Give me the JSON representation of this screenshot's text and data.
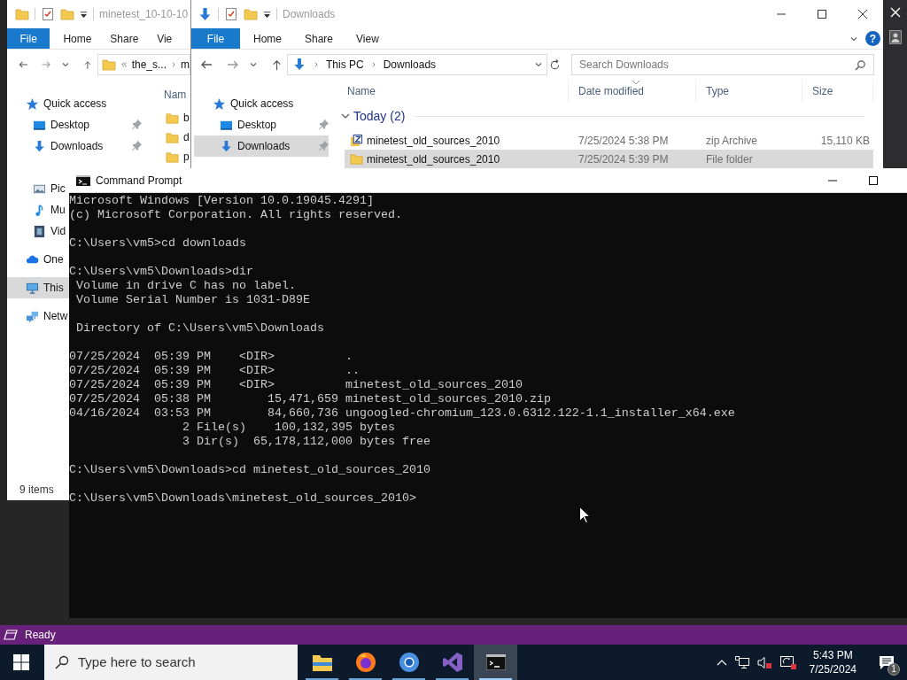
{
  "explorer_back": {
    "title": "minetest_10-10-10",
    "ribbon_tabs": [
      {
        "label": "File",
        "kind": "file"
      },
      {
        "label": "Home",
        "kind": "tab"
      },
      {
        "label": "Share",
        "kind": "tab"
      },
      {
        "label": "Vie",
        "kind": "tab"
      }
    ],
    "address": [
      "the_s...",
      "m"
    ],
    "column_header": "Nam",
    "nav_sections": [
      {
        "items": [
          {
            "label": "Quick access",
            "kind": "quick",
            "pinned": false,
            "selected": false
          },
          {
            "label": "Desktop",
            "kind": "desktop",
            "pinned": true,
            "selected": false
          },
          {
            "label": "Downloads",
            "kind": "downloads",
            "pinned": true,
            "selected": false
          }
        ]
      },
      {
        "items": [
          {
            "label": "Pic",
            "kind": "pictures",
            "selected": false
          },
          {
            "label": "Mu",
            "kind": "music",
            "selected": false
          },
          {
            "label": "Vid",
            "kind": "videos",
            "selected": false
          }
        ]
      },
      {
        "items": [
          {
            "label": "One",
            "kind": "onedrive",
            "selected": false
          }
        ]
      },
      {
        "items": [
          {
            "label": "This",
            "kind": "pc",
            "selected": true
          }
        ]
      },
      {
        "items": [
          {
            "label": "Netw",
            "kind": "network",
            "selected": false
          }
        ]
      }
    ],
    "files": [
      "b",
      "d",
      "p"
    ],
    "status": "9 items"
  },
  "explorer_front": {
    "title": "Downloads",
    "ribbon_tabs": [
      {
        "label": "File",
        "kind": "file"
      },
      {
        "label": "Home",
        "kind": "tab"
      },
      {
        "label": "Share",
        "kind": "tab"
      },
      {
        "label": "View",
        "kind": "tab"
      }
    ],
    "help_label": "?",
    "address": [
      "This PC",
      "Downloads"
    ],
    "search": {
      "placeholder": "Search Downloads"
    },
    "nav_items": [
      {
        "label": "Quick access",
        "kind": "quick",
        "pinned": false,
        "selected": false
      },
      {
        "label": "Desktop",
        "kind": "desktop",
        "pinned": true,
        "selected": false
      },
      {
        "label": "Downloads",
        "kind": "downloads",
        "pinned": true,
        "selected": true
      }
    ],
    "columns": [
      "Name",
      "Date modified",
      "Type",
      "Size"
    ],
    "group": "Today (2)",
    "rows": [
      {
        "kind": "zip",
        "name": "minetest_old_sources_2010",
        "date": "7/25/2024 5:38 PM",
        "type": "zip Archive",
        "size": "15,110 KB",
        "selected": false
      },
      {
        "kind": "folder",
        "name": "minetest_old_sources_2010",
        "date": "7/25/2024 5:39 PM",
        "type": "File folder",
        "selected": true
      }
    ]
  },
  "command_prompt": {
    "title": "Command Prompt",
    "output": "Microsoft Windows [Version 10.0.19045.4291]\n(c) Microsoft Corporation. All rights reserved.\n\nC:\\Users\\vm5>cd downloads\n\nC:\\Users\\vm5\\Downloads>dir\n Volume in drive C has no label.\n Volume Serial Number is 1031-D89E\n\n Directory of C:\\Users\\vm5\\Downloads\n\n07/25/2024  05:39 PM    <DIR>          .\n07/25/2024  05:39 PM    <DIR>          ..\n07/25/2024  05:39 PM    <DIR>          minetest_old_sources_2010\n07/25/2024  05:38 PM        15,471,659 minetest_old_sources_2010.zip\n04/16/2024  03:53 PM        84,660,736 ungoogled-chromium_123.0.6312.122-1.1_installer_x64.exe\n                2 File(s)    100,132,395 bytes\n                3 Dir(s)  65,178,112,000 bytes free\n\nC:\\Users\\vm5\\Downloads>cd minetest_old_sources_2010\n\nC:\\Users\\vm5\\Downloads\\minetest_old_sources_2010>"
  },
  "status_bar": {
    "text": "Ready"
  },
  "taskbar": {
    "search": {
      "placeholder": "Type here to search"
    },
    "apps": [
      {
        "kind": "explorer",
        "running": true,
        "active": false
      },
      {
        "kind": "firefox",
        "running": true,
        "active": false
      },
      {
        "kind": "chromium",
        "running": true,
        "active": false
      },
      {
        "kind": "visualstudio",
        "running": true,
        "active": false
      },
      {
        "kind": "terminal",
        "running": true,
        "active": true
      }
    ],
    "time": "5:43 PM",
    "date": "7/25/2024",
    "notification_count": "1"
  }
}
